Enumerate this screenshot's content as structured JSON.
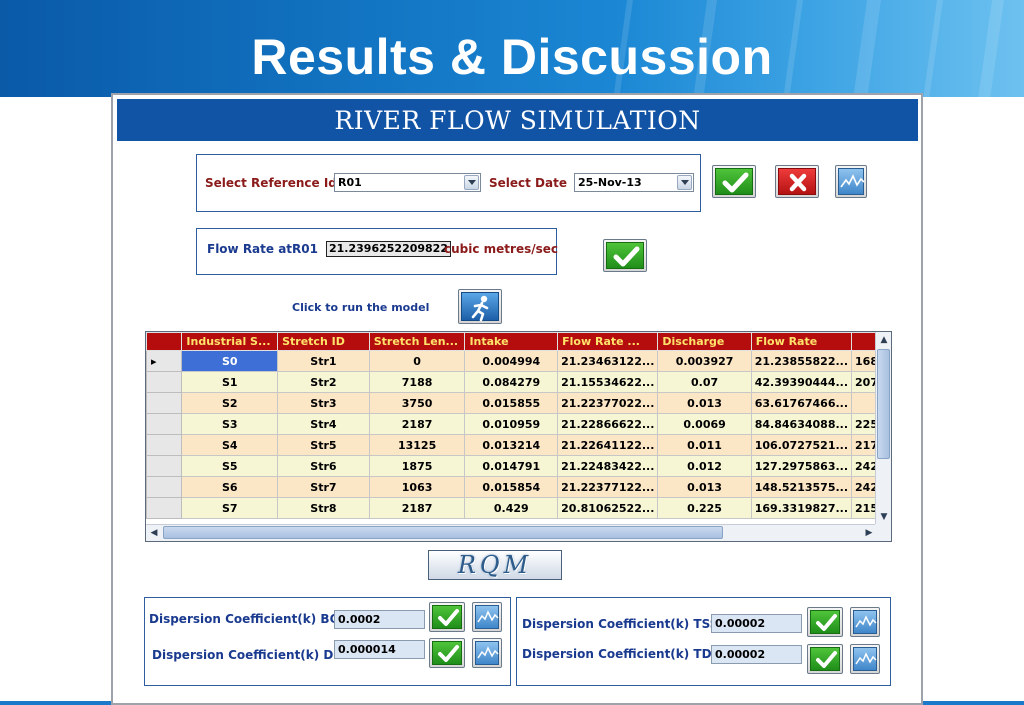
{
  "slide": {
    "title": "Results & Discussion"
  },
  "app": {
    "title": "RIVER FLOW SIMULATION"
  },
  "selection": {
    "ref_label": "Select Reference Id",
    "ref_value": "R01",
    "date_label": "Select Date",
    "date_value": "25-Nov-13"
  },
  "flow": {
    "label": "Flow Rate at",
    "ref": "R01",
    "value": "21.2396252209822",
    "unit": "cubic metres/sec"
  },
  "run": {
    "label": "Click to run the model"
  },
  "grid": {
    "columns": [
      "Industrial S...",
      "Stretch ID",
      "Stretch Len...",
      "Intake",
      "Flow Rate ...",
      "Discharge",
      "Flow Rate",
      ""
    ],
    "rows": [
      [
        "S0",
        "Str1",
        "0",
        "0.004994",
        "21.23463122...",
        "0.003927",
        "21.23855822...",
        "168"
      ],
      [
        "S1",
        "Str2",
        "7188",
        "0.084279",
        "21.15534622...",
        "0.07",
        "42.39390444...",
        "207"
      ],
      [
        "S2",
        "Str3",
        "3750",
        "0.015855",
        "21.22377022...",
        "0.013",
        "63.61767466...",
        ""
      ],
      [
        "S3",
        "Str4",
        "2187",
        "0.010959",
        "21.22866622...",
        "0.0069",
        "84.84634088...",
        "225"
      ],
      [
        "S4",
        "Str5",
        "13125",
        "0.013214",
        "21.22641122...",
        "0.011",
        "106.0727521...",
        "217"
      ],
      [
        "S5",
        "Str6",
        "1875",
        "0.014791",
        "21.22483422...",
        "0.012",
        "127.2975863...",
        "242"
      ],
      [
        "S6",
        "Str7",
        "1063",
        "0.015854",
        "21.22377122...",
        "0.013",
        "148.5213575...",
        "242"
      ],
      [
        "S7",
        "Str8",
        "2187",
        "0.429",
        "20.81062522...",
        "0.225",
        "169.3319827...",
        "215"
      ]
    ]
  },
  "rqm": {
    "label": "RQM"
  },
  "dispersion": {
    "bod": {
      "label": "Dispersion Coefficient(k) BOD",
      "value": "0.0002"
    },
    "do": {
      "label": "Dispersion Coefficient(k) DO",
      "value": "0.000014"
    },
    "tss": {
      "label": "Dispersion Coefficient(k) TSS",
      "value": "0.00002"
    },
    "tds": {
      "label": "Dispersion Coefficient(k) TDS",
      "value": "0.00002"
    }
  },
  "colors": {
    "header_blue": "#1153a4",
    "grid_header": "#b50d0d",
    "grid_header_text": "#ffe36b",
    "row_a": "#fbe6c6",
    "row_b": "#f6f6d4"
  },
  "icons": {
    "ok": "checkmark-icon",
    "cancel": "x-icon",
    "chart": "chart-icon",
    "run": "runner-icon"
  }
}
